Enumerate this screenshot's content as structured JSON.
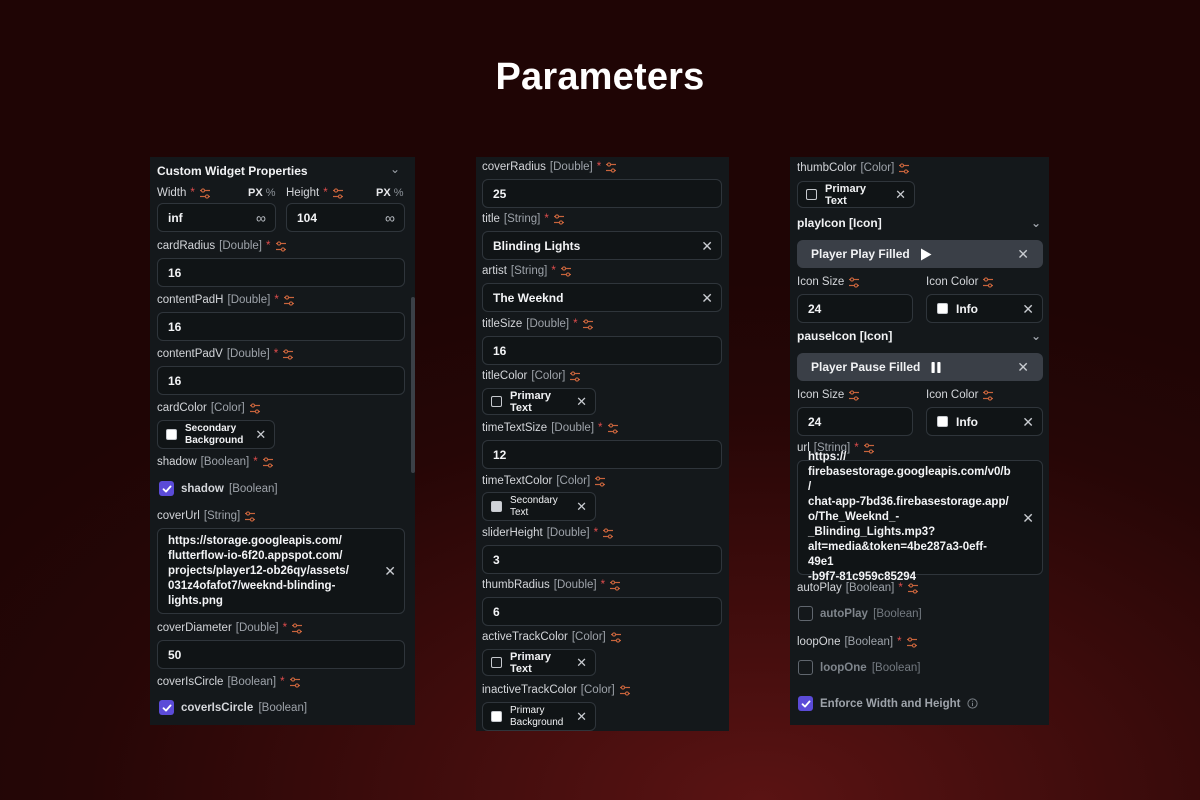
{
  "page": {
    "title": "Parameters"
  },
  "panel1": {
    "header": "Custom Widget Properties",
    "width_label": "Width",
    "height_label": "Height",
    "unit_px": "PX",
    "unit_pct": "%",
    "width_value": "inf",
    "height_value": "104",
    "infinity_symbol": "∞",
    "cardRadius": {
      "name": "cardRadius",
      "type": "[Double]",
      "value": "16"
    },
    "contentPadH": {
      "name": "contentPadH",
      "type": "[Double]",
      "value": "16"
    },
    "contentPadV": {
      "name": "contentPadV",
      "type": "[Double]",
      "value": "16"
    },
    "cardColor": {
      "name": "cardColor",
      "type": "[Color]",
      "value": "Secondary\nBackground",
      "swatch": "#ffffff"
    },
    "shadow": {
      "name": "shadow",
      "type": "[Boolean]",
      "check_name": "shadow",
      "check_type": "[Boolean]",
      "checked": true
    },
    "coverUrl": {
      "name": "coverUrl",
      "type": "[String]",
      "value": "https://storage.googleapis.com/\nflutterflow-io-6f20.appspot.com/\nprojects/player12-ob26qy/assets/\n031z4ofafot7/weeknd-blinding-\nlights.png"
    },
    "coverDiameter": {
      "name": "coverDiameter",
      "type": "[Double]",
      "value": "50"
    },
    "coverIsCircle": {
      "name": "coverIsCircle",
      "type": "[Boolean]",
      "check_name": "coverIsCircle",
      "check_type": "[Boolean]",
      "checked": true
    }
  },
  "panel2": {
    "coverRadius": {
      "name": "coverRadius",
      "type": "[Double]",
      "value": "25"
    },
    "title": {
      "name": "title",
      "type": "[String]",
      "value": "Blinding Lights"
    },
    "artist": {
      "name": "artist",
      "type": "[String]",
      "value": "The Weeknd"
    },
    "titleSize": {
      "name": "titleSize",
      "type": "[Double]",
      "value": "16"
    },
    "titleColor": {
      "name": "titleColor",
      "type": "[Color]",
      "value": "Primary Text",
      "swatch": "#14181b"
    },
    "timeTextSize": {
      "name": "timeTextSize",
      "type": "[Double]",
      "value": "12"
    },
    "timeTextColor": {
      "name": "timeTextColor",
      "type": "[Color]",
      "value": "Secondary\nText",
      "swatch": "#d0d3d8"
    },
    "sliderHeight": {
      "name": "sliderHeight",
      "type": "[Double]",
      "value": "3"
    },
    "thumbRadius": {
      "name": "thumbRadius",
      "type": "[Double]",
      "value": "6"
    },
    "activeTrackColor": {
      "name": "activeTrackColor",
      "type": "[Color]",
      "value": "Primary Text",
      "swatch": "#14181b"
    },
    "inactiveTrackColor": {
      "name": "inactiveTrackColor",
      "type": "[Color]",
      "value": "Primary\nBackground",
      "swatch": "#ffffff"
    }
  },
  "panel3": {
    "thumbColor": {
      "name": "thumbColor",
      "type": "[Color]",
      "value": "Primary Text",
      "swatch": "#14181b"
    },
    "playIcon": {
      "name": "playIcon",
      "type": "[Icon]",
      "value": "Player Play Filled",
      "icon": "play-icon"
    },
    "play_icon_size_label": "Icon Size",
    "play_icon_size": "24",
    "play_icon_color_label": "Icon Color",
    "play_icon_color": "Info",
    "pauseIcon": {
      "name": "pauseIcon",
      "type": "[Icon]",
      "value": "Player Pause Filled",
      "icon": "pause-icon"
    },
    "pause_icon_size_label": "Icon Size",
    "pause_icon_size": "24",
    "pause_icon_color_label": "Icon Color",
    "pause_icon_color": "Info",
    "url": {
      "name": "url",
      "type": "[String]",
      "value": "https://\nfirebasestorage.googleapis.com/v0/b/\nchat-app-7bd36.firebasestorage.app/\no/The_Weeknd_-\n_Blinding_Lights.mp3?\nalt=media&token=4be287a3-0eff-49e1\n-b9f7-81c959c85294"
    },
    "autoPlay": {
      "name": "autoPlay",
      "type": "[Boolean]",
      "check_name": "autoPlay",
      "check_type": "[Boolean]",
      "checked": false
    },
    "loopOne": {
      "name": "loopOne",
      "type": "[Boolean]",
      "check_name": "loopOne",
      "check_type": "[Boolean]",
      "checked": false
    },
    "enforce": {
      "label": "Enforce Width and Height",
      "checked": true
    }
  },
  "colors": {
    "accent": "#5b4bd8",
    "required": "#e04d4d",
    "panel_bg": "#14181b",
    "field_border": "#2f353b"
  }
}
